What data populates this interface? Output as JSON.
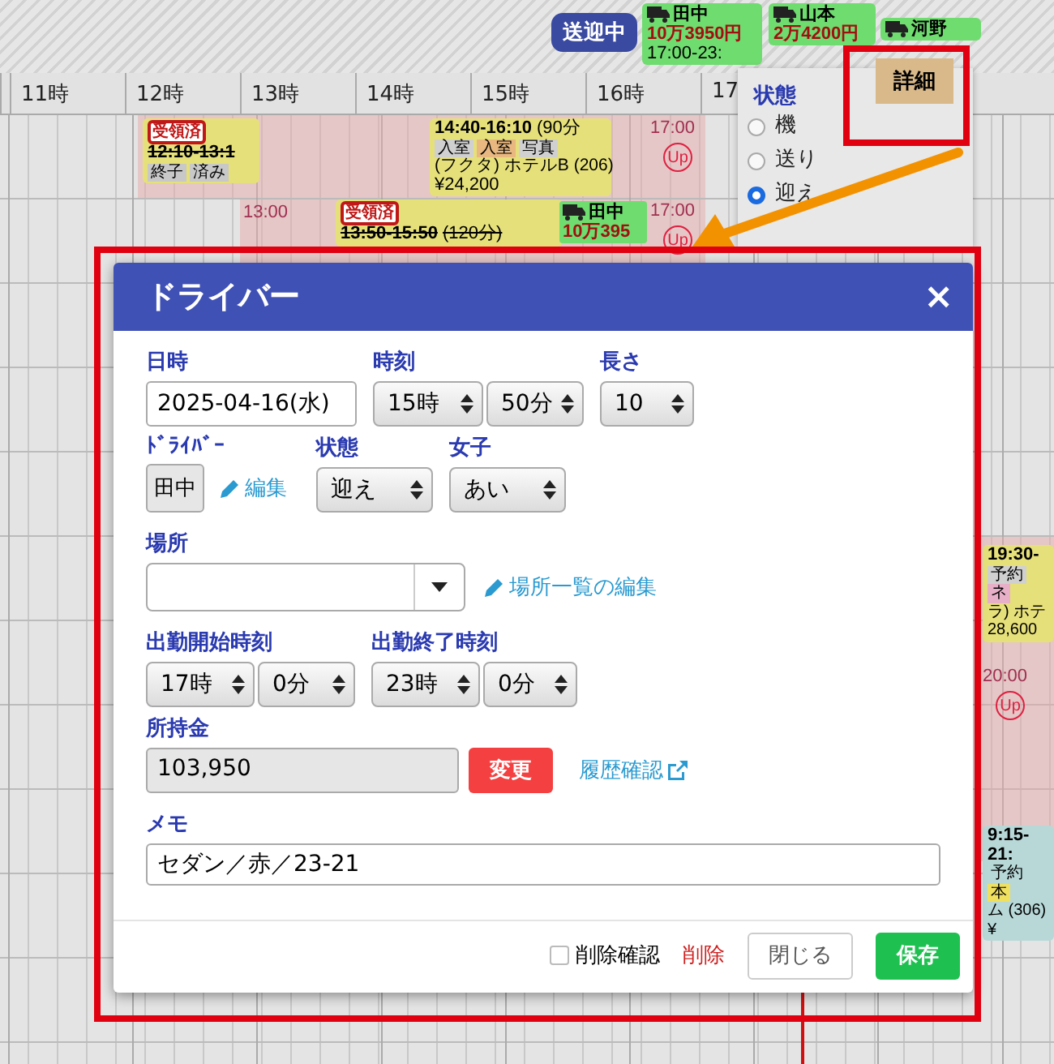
{
  "top_bar": {
    "status_badge": "送迎中",
    "drivers": [
      {
        "name": "田中",
        "amount": "10万3950円",
        "time": "17:00-23:"
      },
      {
        "name": "山本",
        "amount": "2万4200円"
      },
      {
        "name": "河野"
      }
    ]
  },
  "timeline": {
    "hours": [
      "11時",
      "12時",
      "13時",
      "14時",
      "15時",
      "16時",
      "17"
    ],
    "events": [
      {
        "kind": "booking",
        "badge": "受領済",
        "time": "12:10-13:1",
        "struck": true,
        "tags": [
          {
            "label": "終子",
            "color": "#c8c8c8"
          },
          {
            "label": "済み",
            "color": "#c8c8c8"
          }
        ]
      },
      {
        "kind": "booking",
        "time": "14:40-16:10",
        "duration": "(90分",
        "struck": false,
        "tags": [
          {
            "label": "入室",
            "color": "#d0d0d0"
          },
          {
            "label": "入室",
            "color": "#e8b880"
          },
          {
            "label": "写真",
            "color": "#d0d0d0"
          }
        ],
        "text": "(フクタ) ホテルB (206)",
        "price": "¥24,200"
      },
      {
        "kind": "marker",
        "time": "17:00",
        "icon_text": "Up"
      },
      {
        "kind": "label",
        "time": "13:00"
      },
      {
        "kind": "booking",
        "badge": "受領済",
        "time": "13:50-15:50",
        "duration": "(120分)",
        "struck": true
      },
      {
        "kind": "driver",
        "name": "田中",
        "amount": "10万395"
      },
      {
        "kind": "marker",
        "time": "17:00",
        "icon_text": "Up"
      },
      {
        "kind": "booking",
        "time": "19:30-",
        "struck": false,
        "tags": [
          {
            "label": "予約",
            "color": "#d0d0d0"
          },
          {
            "label": "ネ",
            "color": "#e8b0c8"
          }
        ],
        "text": "ラ) ホテ",
        "price": "28,600"
      },
      {
        "kind": "marker",
        "time": "20:00",
        "icon_text": "Up"
      },
      {
        "kind": "booking",
        "time": "9:15-21:",
        "struck": false,
        "tags": [
          {
            "label": "予約",
            "color": "#b8d8d8"
          },
          {
            "label": "本",
            "color": "#f0e060"
          }
        ],
        "text": "ム (306) ¥"
      }
    ]
  },
  "status_menu": {
    "title": "状態",
    "options": [
      {
        "label": "機",
        "selected": false
      },
      {
        "label": "送り",
        "selected": false
      },
      {
        "label": "迎え",
        "selected": true
      }
    ],
    "detail_button": "詳細"
  },
  "dialog": {
    "title": "ドライバー",
    "close": "×",
    "date": {
      "label": "日時",
      "value": "2025-04-16(水)"
    },
    "time": {
      "label": "時刻",
      "hour": "15時",
      "minute": "50分"
    },
    "length": {
      "label": "長さ",
      "value": "10"
    },
    "driver": {
      "label": "ﾄﾞﾗｲﾊﾞｰ",
      "value": "田中",
      "edit_link": "編集"
    },
    "state": {
      "label": "状態",
      "value": "迎え"
    },
    "girl": {
      "label": "女子",
      "value": "あい"
    },
    "place": {
      "label": "場所",
      "edit_link": "場所一覧の編集"
    },
    "shift_start": {
      "label": "出勤開始時刻",
      "hour": "17時",
      "minute": "0分"
    },
    "shift_end": {
      "label": "出勤終了時刻",
      "hour": "23時",
      "minute": "0分"
    },
    "cash": {
      "label": "所持金",
      "value": "103,950",
      "change_button": "変更",
      "history_link": "履歴確認"
    },
    "memo": {
      "label": "メモ",
      "value": "セダン／赤／23-21"
    },
    "footer": {
      "delete_confirm": {
        "label": "削除確認",
        "checked": false
      },
      "delete": "削除",
      "close": "閉じる",
      "save": "保存"
    }
  }
}
